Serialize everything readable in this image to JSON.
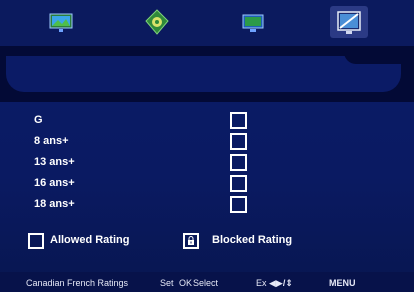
{
  "tabs": [
    {
      "name": "picture-tab-icon",
      "active": false
    },
    {
      "name": "audio-tab-icon",
      "active": false
    },
    {
      "name": "channel-tab-icon",
      "active": false
    },
    {
      "name": "lock-tab-icon",
      "active": true
    }
  ],
  "ratings": [
    {
      "label": "G",
      "blocked": false
    },
    {
      "label": "8 ans+",
      "blocked": false
    },
    {
      "label": "13 ans+",
      "blocked": false
    },
    {
      "label": "16 ans+",
      "blocked": false
    },
    {
      "label": "18 ans+",
      "blocked": false
    }
  ],
  "legend": {
    "allowed_label": "Allowed Rating",
    "blocked_label": "Blocked Rating"
  },
  "footer": {
    "title": "Canadian French Ratings",
    "set_label": "Set",
    "ok_label": "OK",
    "select_label": "Select",
    "exit_label": "Ex",
    "arrows_label": "◀▶/⇕",
    "menu_label": "MENU"
  },
  "colors": {
    "background": "#0a1a62",
    "panel": "#030a36",
    "text": "#ffffff"
  }
}
